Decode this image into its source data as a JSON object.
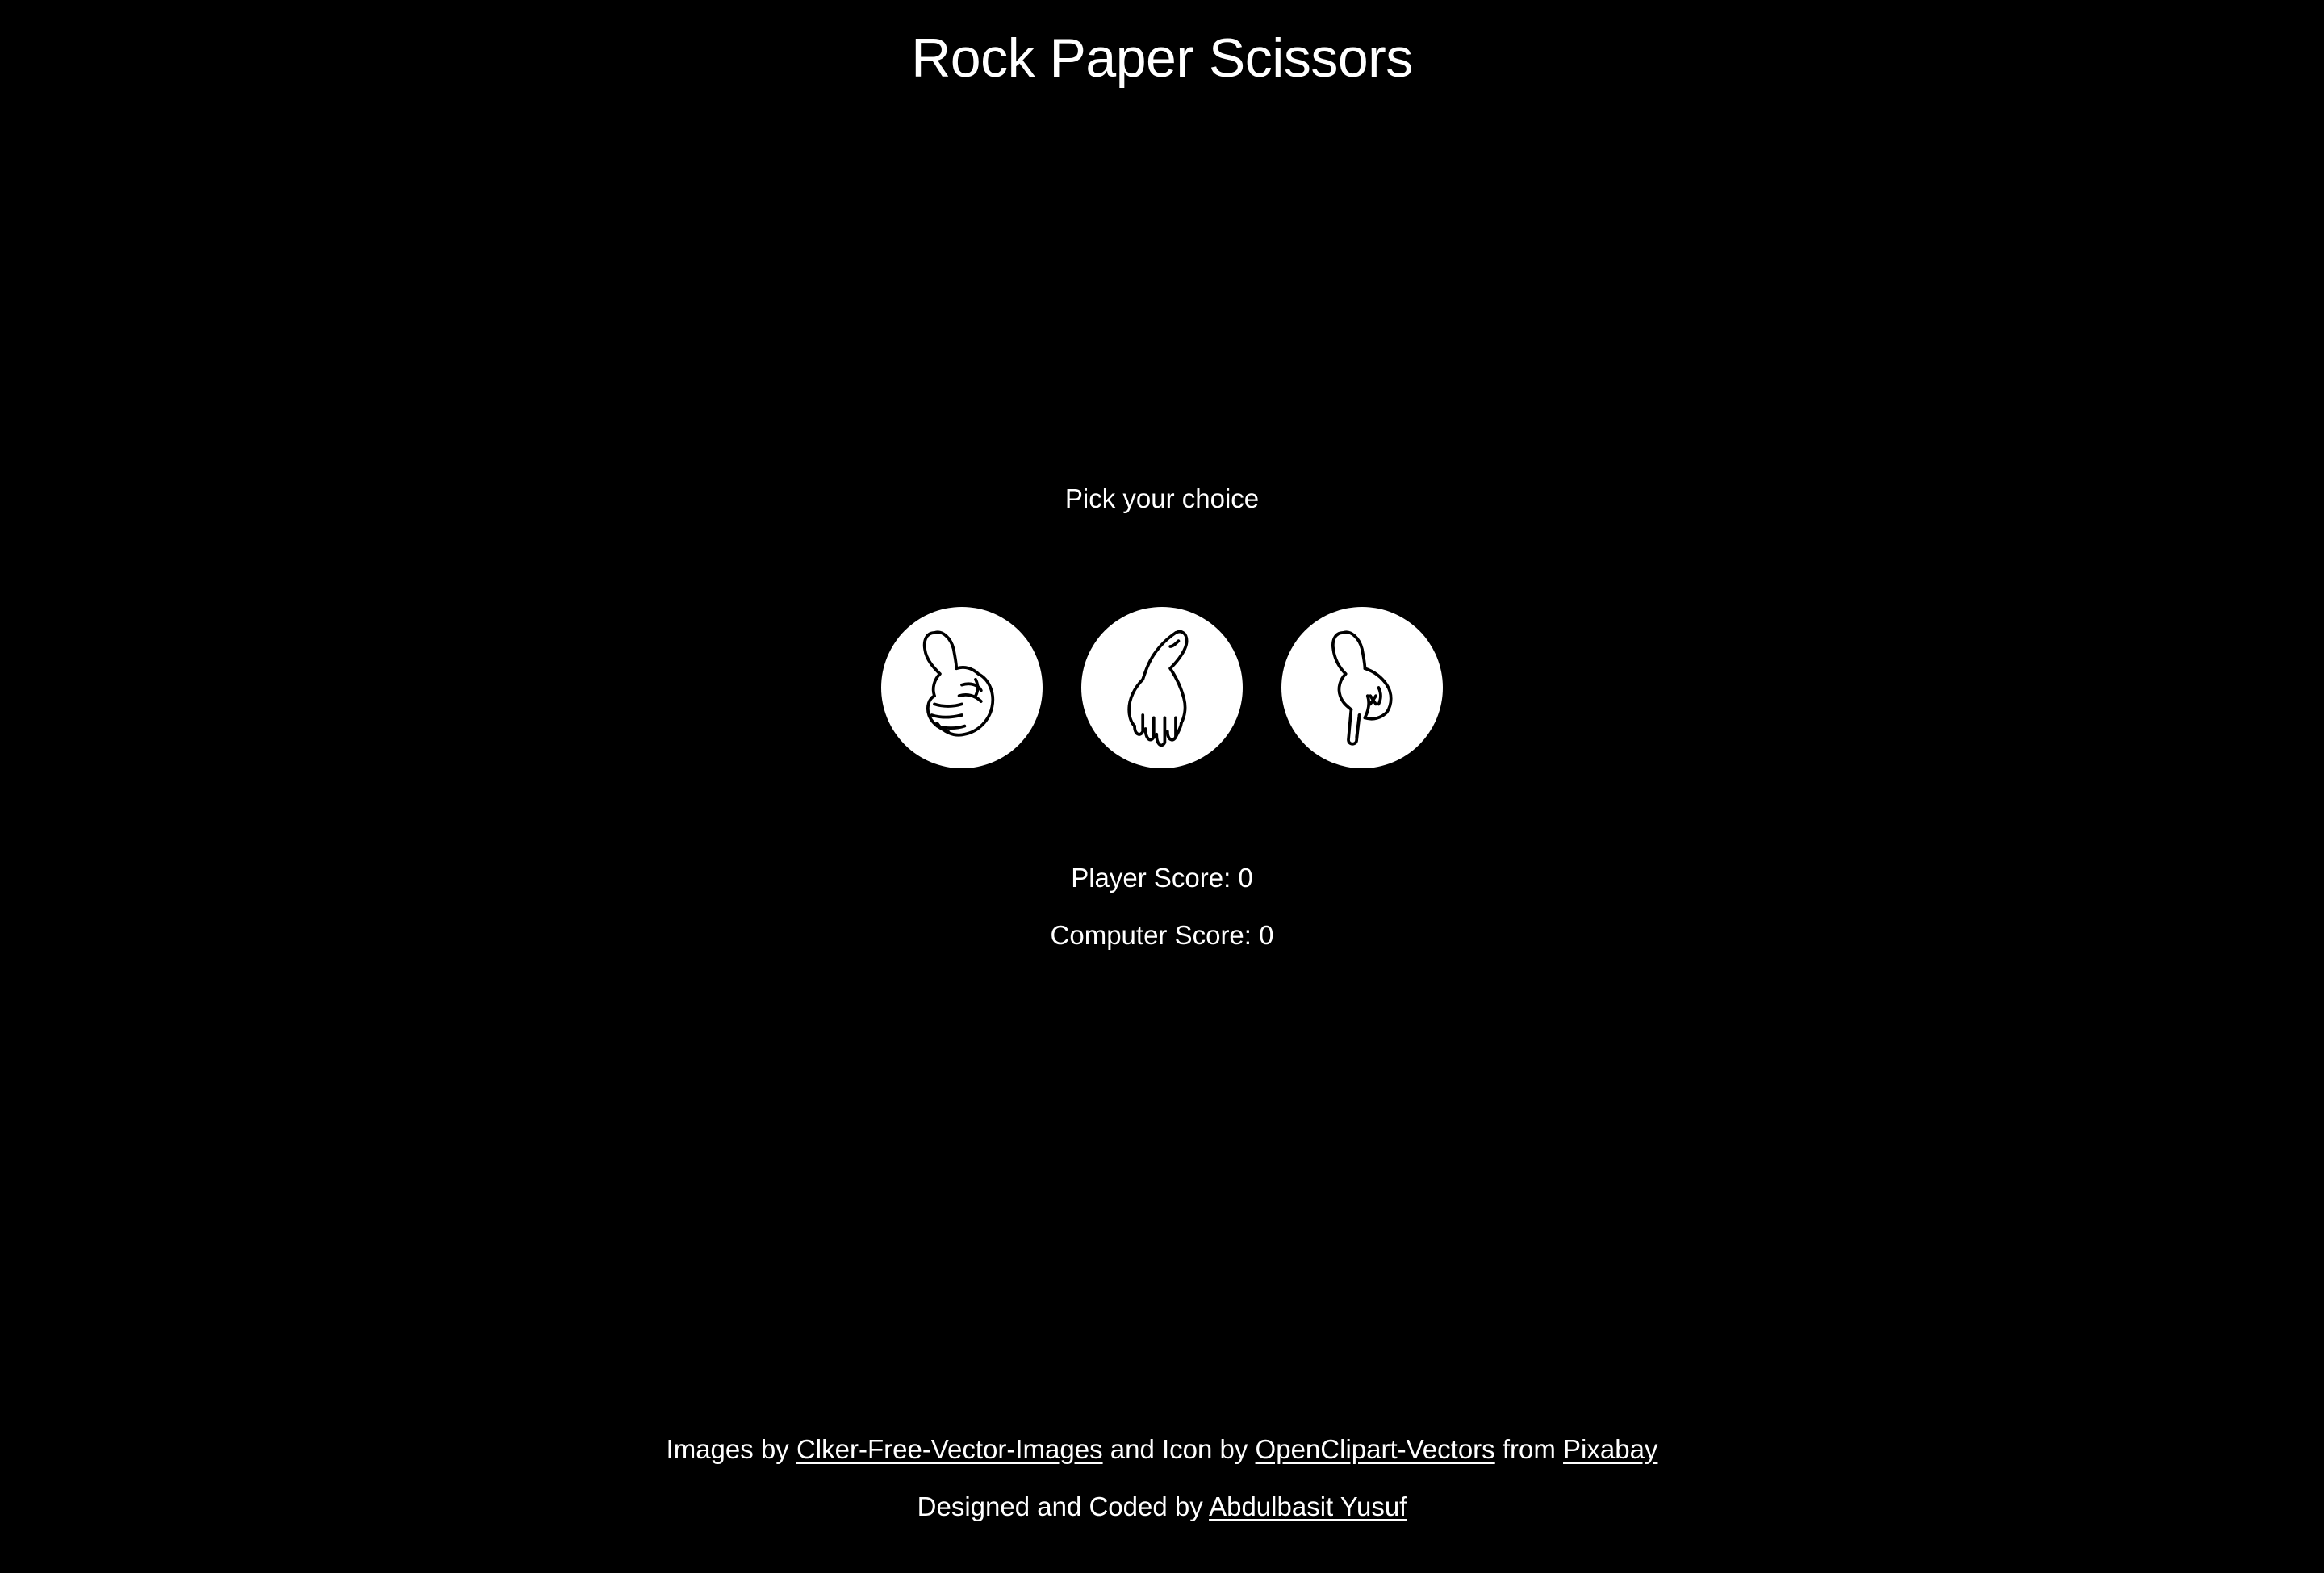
{
  "header": {
    "title": "Rock Paper Scissors"
  },
  "game": {
    "prompt": "Pick your choice",
    "choices": [
      {
        "name": "rock",
        "icon": "rock-hand-icon"
      },
      {
        "name": "paper",
        "icon": "paper-hand-icon"
      },
      {
        "name": "scissors",
        "icon": "scissors-hand-icon"
      }
    ],
    "player_score_label": "Player Score: 0",
    "computer_score_label": "Computer Score: 0"
  },
  "footer": {
    "images_by_text": "Images by ",
    "images_link": "Clker-Free-Vector-Images",
    "and_icon_text": " and Icon by ",
    "icon_link": "OpenClipart-Vectors",
    "from_text": " from ",
    "source_link": "Pixabay",
    "designed_text": "Designed and Coded by ",
    "author_link": "Abdulbasit Yusuf"
  },
  "colors": {
    "background": "#000000",
    "text": "#ffffff",
    "choice_background": "#ffffff"
  }
}
